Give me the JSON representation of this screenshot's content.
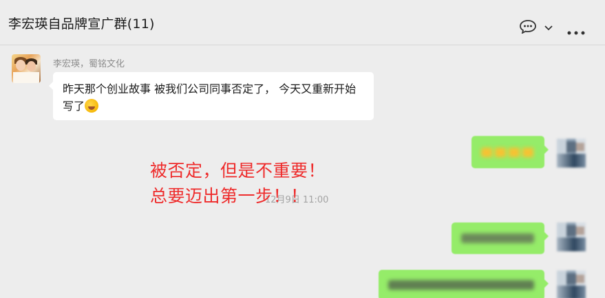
{
  "header": {
    "title": "李宏瑛自品牌宣广群(11)",
    "icons": [
      "chat-bubble-icon",
      "chevron-down-icon",
      "more-icon"
    ]
  },
  "messages": [
    {
      "side": "left",
      "sender": "李宏瑛，蜀铭文化",
      "text": "昨天那个创业故事  被我们公司同事否定了，  今天又重新开始写了",
      "emoji": "rolling-laugh-emoji"
    }
  ],
  "timestamp": "12月9日 11:00",
  "overlay": {
    "line1": "被否定，但是不重要！",
    "line2": "总要迈出第一步！！",
    "color": "#ee2b2b"
  },
  "colors": {
    "bubble_self": "#95ec69",
    "bubble_other": "#ffffff",
    "background": "#ededed"
  }
}
